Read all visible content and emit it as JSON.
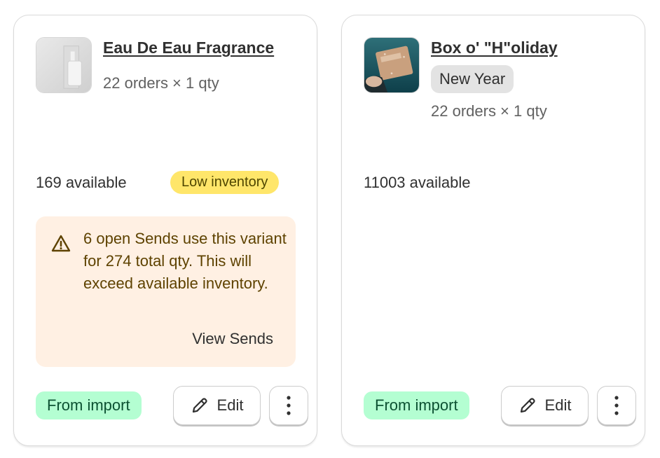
{
  "cards": [
    {
      "title": "Eau De Eau Fragrance",
      "orders": "22 orders × 1 qty",
      "available": "169 available",
      "status_badge": "Low inventory",
      "warning": {
        "text": "6 open Sends use this variant for 274 total qty. This will exceed available inventory.",
        "link": "View Sends"
      },
      "source_badge": "From import",
      "edit_label": "Edit",
      "icons": {
        "thumbnail": "product-thumbnail",
        "warning": "warning-triangle-icon",
        "edit": "pencil-icon",
        "more": "more-vertical-icon"
      }
    },
    {
      "title": "Box o' \"H\"oliday",
      "tag": "New Year",
      "orders": "22 orders × 1 qty",
      "available": "11003 available",
      "source_badge": "From import",
      "edit_label": "Edit",
      "icons": {
        "thumbnail": "product-thumbnail",
        "edit": "pencil-icon",
        "more": "more-vertical-icon"
      }
    }
  ],
  "colors": {
    "low_inventory_bg": "#ffe66a",
    "warning_bg": "#fff0e3",
    "warning_text": "#5e4200",
    "import_bg": "#b4fed2",
    "import_text": "#0c5132",
    "tag_bg": "#e3e3e3"
  }
}
